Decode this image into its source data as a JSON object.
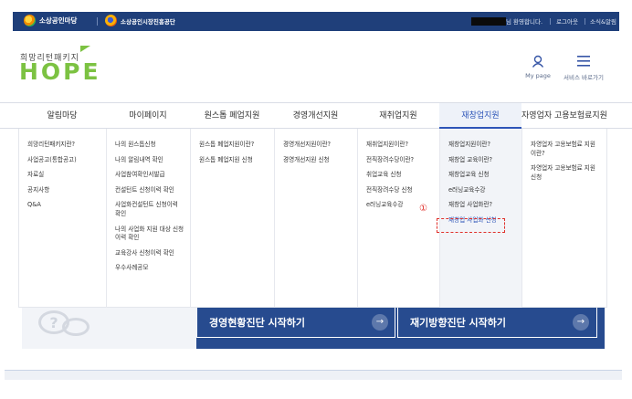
{
  "topbar": {
    "brand1": "소상공인마당",
    "brand2": "소상공인시장진흥공단",
    "greeting": "님 환영합니다.",
    "logout": "로그아웃",
    "news": "소식&알림"
  },
  "header": {
    "logo_sub": "희망리턴패키지",
    "logo_main": "HOPE",
    "mypage_label": "My page",
    "menu_label": "서비스 바로가기"
  },
  "gnb": [
    {
      "label": "알림마당"
    },
    {
      "label": "마이페이지"
    },
    {
      "label": "원스톱 폐업지원"
    },
    {
      "label": "경영개선지원"
    },
    {
      "label": "재취업지원"
    },
    {
      "label": "재창업지원"
    },
    {
      "label": "자영업자 고용보험료지원"
    }
  ],
  "columns": [
    {
      "items": [
        "희망리턴패키지란?",
        "사업공고(통합공고)",
        "자료실",
        "공지사항",
        "Q&A"
      ]
    },
    {
      "items": [
        "나의 원스톱신청",
        "나의 알림내역 확인",
        "사업참여확인서발급",
        "컨설턴트 신청이력 확인",
        "사업화컨설턴트 신청이력 확인",
        "나의 사업화 지원 대상 신청 이력 확인",
        "교육강사 신청이력 확인",
        "우수사례공모"
      ]
    },
    {
      "items": [
        "원스톱 폐업지원이란?",
        "원스톱 폐업지원 신청"
      ]
    },
    {
      "items": [
        "경영개선지원이란?",
        "경영개선지원 신청"
      ]
    },
    {
      "items": [
        "재취업지원이란?",
        "전직장려수당이란?",
        "취업교육 신청",
        "전직장려수당 신청",
        "e러닝교육수강"
      ]
    },
    {
      "items": [
        "재창업지원이란?",
        "재창업 교육이란?",
        "재창업교육 신청",
        "e러닝교육수강",
        "재창업 사업화란?",
        "재창업 사업화 신청"
      ]
    },
    {
      "items": [
        "자영업자 고용보험료 지원 이란?",
        "자영업자 고용보험료 지원 신청"
      ]
    }
  ],
  "annotation": {
    "marker": "①"
  },
  "banner": {
    "cta1": "경영현황진단 시작하기",
    "cta2": "재기방향진단 시작하기",
    "arrow": "→",
    "bubble_glyph": "?"
  },
  "colors": {
    "primary": "#1f3f7a",
    "accent": "#2d55b8",
    "brand_green": "#7cc242",
    "highlight": "#e0302b"
  }
}
